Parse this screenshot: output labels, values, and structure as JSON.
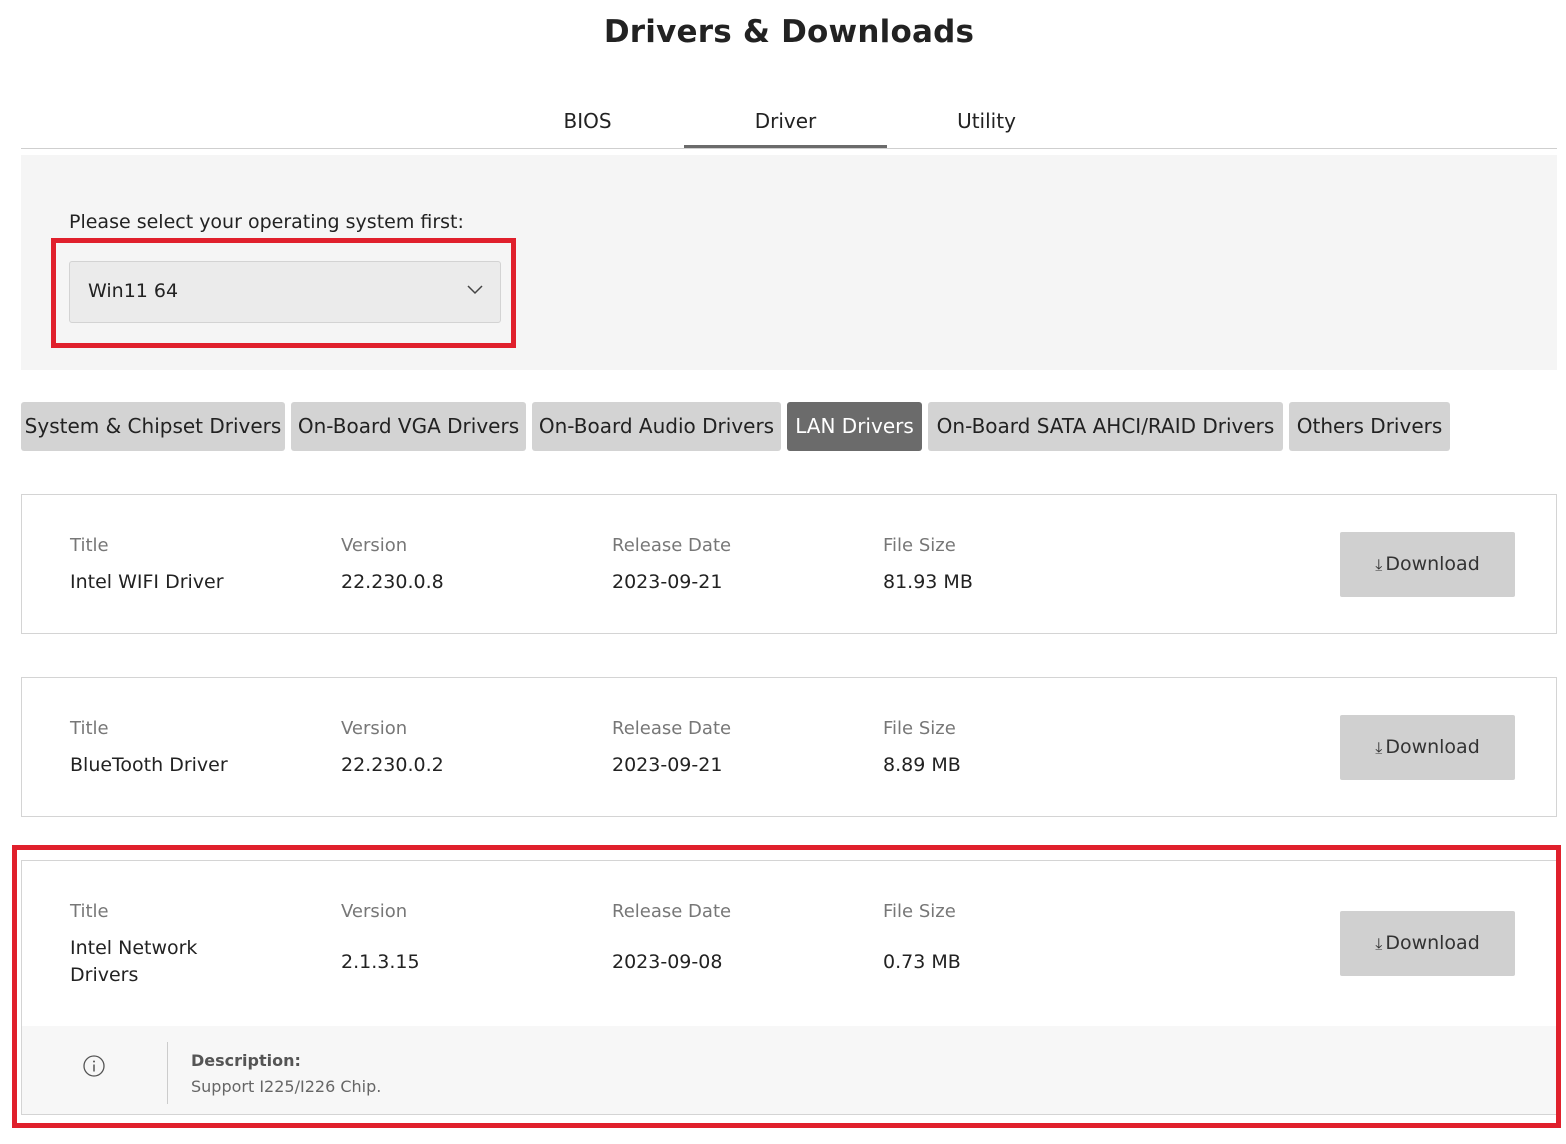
{
  "page": {
    "title": "Drivers & Downloads"
  },
  "main_tabs": [
    {
      "label": "BIOS",
      "active": false
    },
    {
      "label": "Driver",
      "active": true
    },
    {
      "label": "Utility",
      "active": false
    }
  ],
  "os_selector": {
    "label": "Please select your operating system first:",
    "value": "Win11 64",
    "icon": "chevron-down-icon"
  },
  "category_tabs": [
    {
      "label": "System & Chipset Drivers",
      "active": false
    },
    {
      "label": "On-Board VGA Drivers",
      "active": false
    },
    {
      "label": "On-Board Audio Drivers",
      "active": false
    },
    {
      "label": "LAN Drivers",
      "active": true
    },
    {
      "label": "On-Board SATA AHCI/RAID Drivers",
      "active": false
    },
    {
      "label": "Others Drivers",
      "active": false
    }
  ],
  "columns": {
    "title": "Title",
    "version": "Version",
    "release_date": "Release Date",
    "file_size": "File Size"
  },
  "drivers": [
    {
      "title": "Intel WIFI Driver",
      "version": "22.230.0.8",
      "release_date": "2023-09-21",
      "file_size": "81.93 MB",
      "download_label": "Download"
    },
    {
      "title": "BlueTooth Driver",
      "version": "22.230.0.2",
      "release_date": "2023-09-21",
      "file_size": "8.89 MB",
      "download_label": "Download"
    },
    {
      "title": "Intel Network Drivers",
      "version": "2.1.3.15",
      "release_date": "2023-09-08",
      "file_size": "0.73 MB",
      "download_label": "Download",
      "description_label": "Description:",
      "description": "Support I225/I226 Chip."
    }
  ],
  "icons": {
    "download": "⤓",
    "info": "info-icon"
  },
  "colors": {
    "highlight": "#e0202c",
    "active_tab": "#6b6b6b",
    "inactive_tab": "#d3d3d3",
    "panel": "#f5f5f5"
  }
}
